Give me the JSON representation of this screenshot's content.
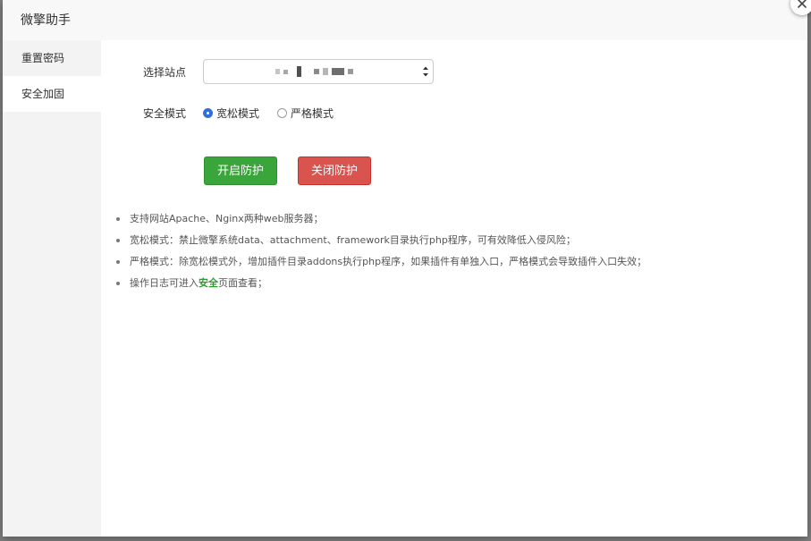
{
  "modal": {
    "title": "微擎助手",
    "close_icon": "close-icon"
  },
  "sidebar": {
    "items": [
      {
        "label": "重置密码",
        "active": false
      },
      {
        "label": "安全加固",
        "active": true
      }
    ]
  },
  "form": {
    "site_label": "选择站点",
    "site_value_obscured": true,
    "mode_label": "安全模式",
    "mode_options": [
      {
        "label": "宽松模式",
        "checked": true
      },
      {
        "label": "严格模式",
        "checked": false
      }
    ]
  },
  "buttons": {
    "enable_label": "开启防护",
    "disable_label": "关闭防护",
    "enable_color": "#3aa53a",
    "disable_color": "#d9534f"
  },
  "notes": [
    "支持网站Apache、Nginx两种web服务器；",
    "宽松模式：禁止微擎系统data、attachment、framework目录执行php程序，可有效降低入侵风险；",
    "严格模式：除宽松模式外，增加插件目录addons执行php程序，如果插件有单独入口，严格模式会导致插件入口失效；"
  ],
  "note_last": {
    "prefix": "操作日志可进入",
    "link": "安全",
    "suffix": "页面查看；"
  },
  "colors": {
    "accent_radio": "#2e6fd8",
    "link_green": "#2d9a2d"
  }
}
